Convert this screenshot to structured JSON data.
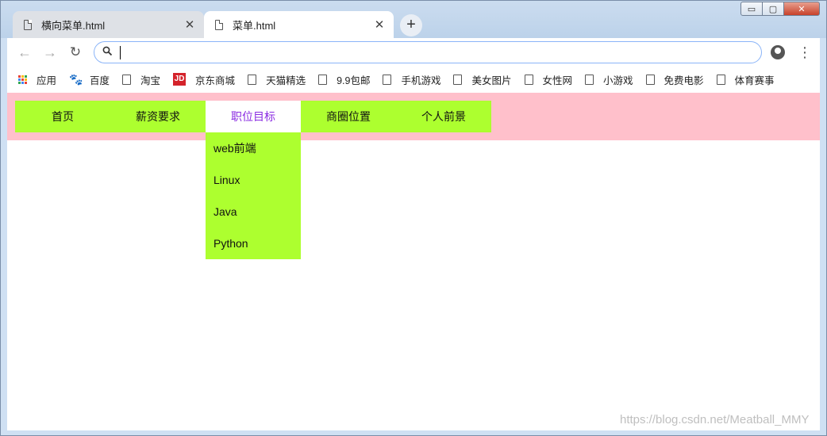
{
  "window": {
    "controls": {
      "minimize": "▭",
      "maximize": "▢",
      "close": "✕"
    }
  },
  "tabs": [
    {
      "title": "横向菜单.html",
      "close": "✕",
      "active": false
    },
    {
      "title": "菜单.html",
      "close": "✕",
      "active": true
    }
  ],
  "new_tab": "+",
  "toolbar": {
    "back": "←",
    "forward": "→",
    "reload": "↻",
    "omnibox_value": "",
    "search_icon": "search-icon",
    "menu": "⋮"
  },
  "bookmarks": [
    {
      "label": "应用",
      "icon": "apps-icon"
    },
    {
      "label": "百度",
      "icon": "baidu-paw-icon"
    },
    {
      "label": "淘宝",
      "icon": "document-icon"
    },
    {
      "label": "京东商城",
      "icon": "jd-icon",
      "icon_text": "JD"
    },
    {
      "label": "天猫精选",
      "icon": "document-icon"
    },
    {
      "label": "9.9包邮",
      "icon": "document-icon"
    },
    {
      "label": "手机游戏",
      "icon": "document-icon"
    },
    {
      "label": "美女图片",
      "icon": "document-icon"
    },
    {
      "label": "女性网",
      "icon": "document-icon"
    },
    {
      "label": "小游戏",
      "icon": "document-icon"
    },
    {
      "label": "免费电影",
      "icon": "document-icon"
    },
    {
      "label": "体育赛事",
      "icon": "document-icon"
    }
  ],
  "page": {
    "menu": [
      {
        "label": "首页"
      },
      {
        "label": "薪资要求"
      },
      {
        "label": "职位目标",
        "active": true
      },
      {
        "label": "商圈位置"
      },
      {
        "label": "个人前景"
      }
    ],
    "submenu": [
      "web前端",
      "Linux",
      "Java",
      "Python"
    ],
    "colors": {
      "menu_bar_bg": "#ffc0cb",
      "menu_item_bg": "#adff2f",
      "active_item_bg": "#ffffff",
      "active_item_text": "#8a2be2"
    }
  },
  "watermark": "https://blog.csdn.net/Meatball_MMY"
}
